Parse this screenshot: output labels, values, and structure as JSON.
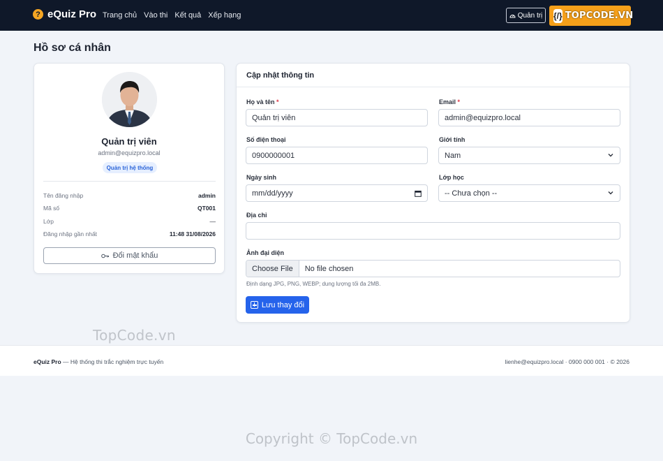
{
  "navbar": {
    "brand": "eQuiz Pro",
    "brand_icon": "?",
    "links": [
      "Trang chủ",
      "Vào thi",
      "Kết quả",
      "Xếp hạng"
    ],
    "admin_button": "Quản trị",
    "watermark_badge": "{/}",
    "watermark_text": "TOPCODE.VN"
  },
  "page_title": "Hồ sơ cá nhân",
  "profile": {
    "name": "Quản trị viên",
    "email": "admin@equizpro.local",
    "role": "Quản trị hệ thống",
    "info": [
      {
        "label": "Tên đăng nhập",
        "value": "admin"
      },
      {
        "label": "Mã số",
        "value": "QT001"
      },
      {
        "label": "Lớp",
        "value": "—"
      },
      {
        "label": "Đăng nhập gần nhất",
        "value": "11:48 31/08/2026"
      }
    ],
    "change_password": "Đổi mật khẩu"
  },
  "form": {
    "header": "Cập nhật thông tin",
    "fullname_label": "Họ và tên",
    "fullname_value": "Quản trị viên",
    "email_label": "Email",
    "email_value": "admin@equizpro.local",
    "phone_label": "Số điện thoại",
    "phone_value": "0900000001",
    "gender_label": "Giới tính",
    "gender_value": "Nam",
    "dob_label": "Ngày sinh",
    "dob_placeholder": "mm/dd/yyyy",
    "class_label": "Lớp học",
    "class_value": "-- Chưa chọn --",
    "address_label": "Địa chỉ",
    "address_value": "",
    "avatar_label": "Ảnh đại diện",
    "file_button": "Choose File",
    "file_status": "No file chosen",
    "hint": "Định dạng JPG, PNG, WEBP; dung lượng tối đa 2MB.",
    "save": "Lưu thay đổi",
    "required_mark": "*"
  },
  "watermark_mid": "TopCode.vn",
  "footer": {
    "brand": "eQuiz Pro",
    "tagline": " — Hệ thống thi trắc nghiệm trực tuyến",
    "contact": "lienhe@equizpro.local · 0900 000 001 · © 2026"
  },
  "copyright": "Copyright © TopCode.vn",
  "colors": {
    "navbar_bg": "#0f1829",
    "primary": "#2563eb",
    "accent": "#f5a623",
    "required": "#dc3545"
  }
}
